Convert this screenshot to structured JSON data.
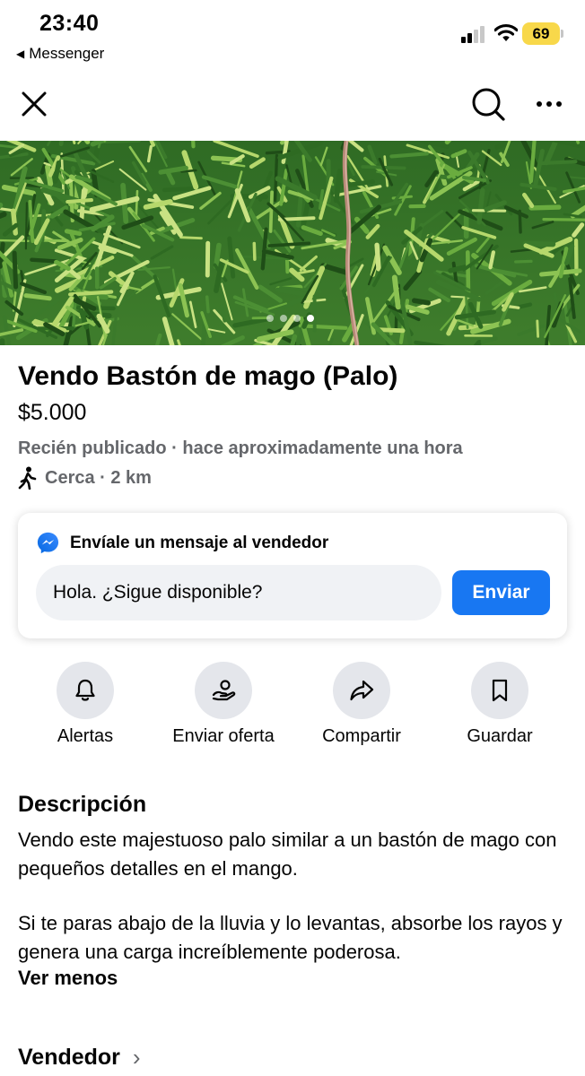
{
  "status_bar": {
    "time": "23:40",
    "back_app": "Messenger",
    "battery": "69",
    "back_glyph": "◀"
  },
  "nav": {
    "close_icon": "close-icon",
    "search_icon": "search-icon",
    "more_icon": "more-icon"
  },
  "photo": {
    "page_count": 4,
    "active_page": 4
  },
  "listing": {
    "title": "Vendo Bastón de mago (Palo)",
    "price": "$5.000",
    "posted": "Recién publicado · hace aproximadamente una hora",
    "location": "Cerca · 2 km"
  },
  "message": {
    "heading": "Envíale un mensaje al vendedor",
    "input_value": "Hola. ¿Sigue disponible?",
    "send_label": "Enviar"
  },
  "actions": [
    {
      "label": "Alertas",
      "icon": "bell-icon"
    },
    {
      "label": "Enviar oferta",
      "icon": "offer-hand-icon"
    },
    {
      "label": "Compartir",
      "icon": "share-arrow-icon"
    },
    {
      "label": "Guardar",
      "icon": "bookmark-icon"
    }
  ],
  "description": {
    "title": "Descripción",
    "paragraph1": "Vendo este majestuoso palo similar a un bastón de mago con pequeños detalles en el mango.",
    "paragraph2": "Si te paras abajo de la lluvia y lo levantas, absorbe los rayos y genera una carga increíblemente poderosa.",
    "see_less": "Ver menos"
  },
  "seller": {
    "label": "Vendedor",
    "chevron": "›"
  },
  "colors": {
    "accent": "#1877f2",
    "battery": "#f8d84a",
    "secondary_text": "#65676b",
    "button_bg": "#e4e6eb"
  }
}
